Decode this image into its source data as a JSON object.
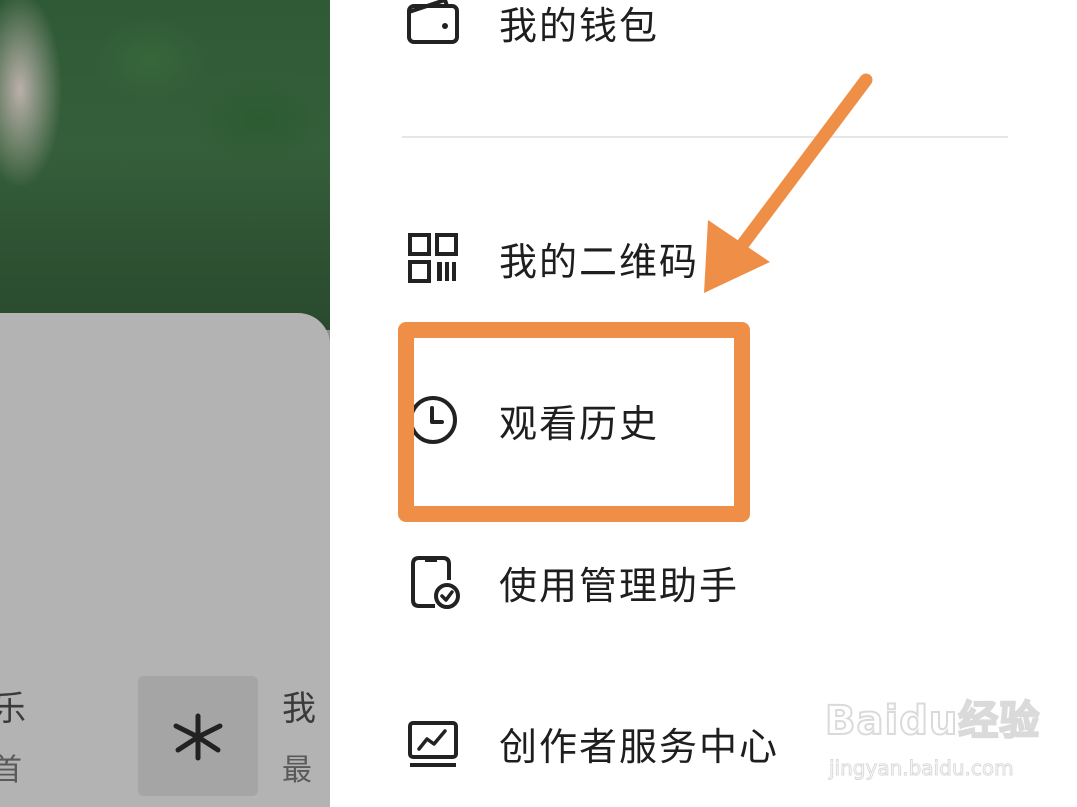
{
  "menu": {
    "items": [
      {
        "label": "我的钱包",
        "icon": "wallet-icon"
      },
      {
        "label": "我的二维码",
        "icon": "qr-code-icon"
      },
      {
        "label": "观看历史",
        "icon": "clock-icon"
      },
      {
        "label": "使用管理助手",
        "icon": "phone-check-icon"
      },
      {
        "label": "创作者服务中心",
        "icon": "chart-monitor-icon"
      }
    ]
  },
  "background_app": {
    "item1_title": "乐",
    "item1_sub": "首",
    "item2_title": "我",
    "item2_sub": "最",
    "tile_icon": "asterisk-icon"
  },
  "annotation": {
    "color": "#ef8f47",
    "highlighted_item": "观看历史"
  },
  "watermark": {
    "brand": "Baidu经验",
    "url": "jingyan.baidu.com"
  }
}
